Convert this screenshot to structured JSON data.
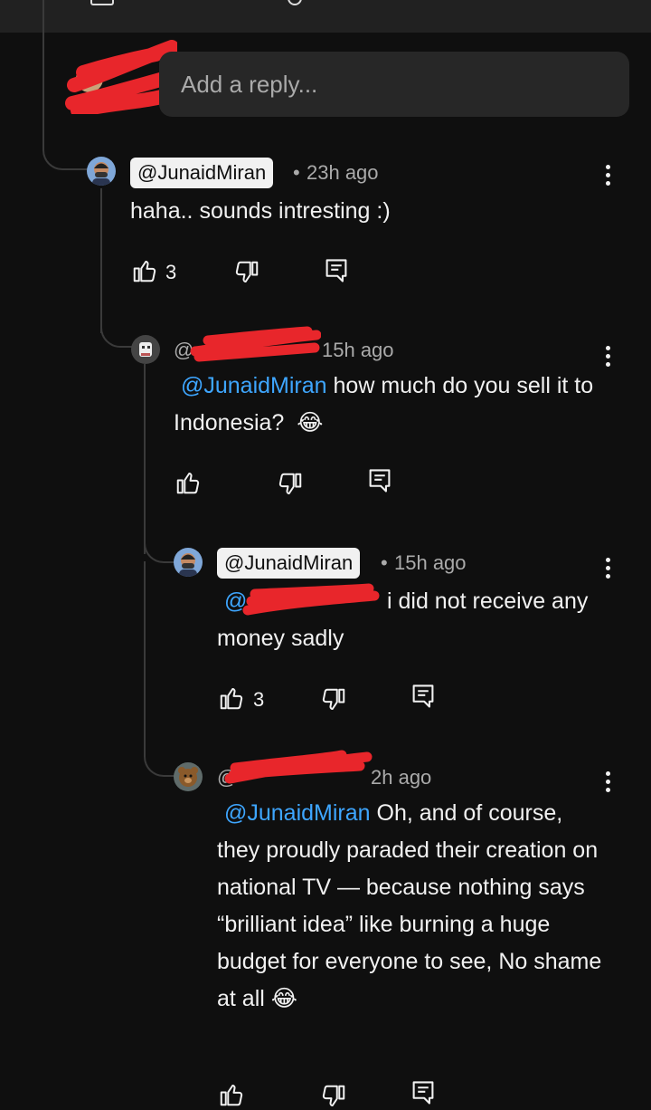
{
  "reply_input": {
    "placeholder": "Add a reply..."
  },
  "comments": [
    {
      "author": "@JunaidMiran",
      "time": "23h ago",
      "text": "haha.. sounds intresting :)",
      "likes": "3"
    },
    {
      "author_visible": "@",
      "time": "15h ago",
      "mention": "@JunaidMiran",
      "text": " how much do you sell it to Indonesia?",
      "emoji": "😂"
    },
    {
      "author": "@JunaidMiran",
      "time": "15h ago",
      "mention_visible": "@",
      "text": "i did not receive any money sadly",
      "likes": "3"
    },
    {
      "author_visible": "@",
      "time": "2h ago",
      "mention": "@JunaidMiran",
      "text": " Oh, and of course, they proudly paraded their creation on national TV — because nothing says “brilliant idea” like burning a huge budget for everyone to see, No shame at all",
      "emoji": "😂"
    }
  ],
  "separator": "•",
  "icons": [
    "like-icon",
    "dislike-icon",
    "reply-icon",
    "more-vert-icon"
  ],
  "colors": {
    "background": "#0f0f0f",
    "mention": "#3ea6ff",
    "redaction": "#e8262b",
    "muted": "#aaaaaa"
  }
}
